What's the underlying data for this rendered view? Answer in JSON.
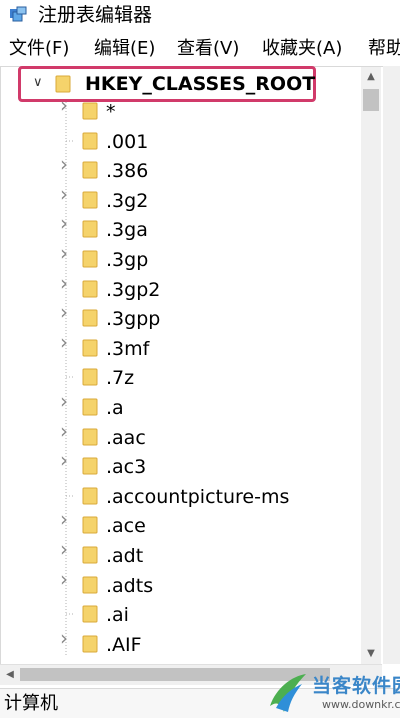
{
  "window": {
    "title": "注册表编辑器"
  },
  "menu": [
    "文件(F)",
    "编辑(E)",
    "查看(V)",
    "收藏夹(A)",
    "帮助(H)"
  ],
  "tree": {
    "root_label": "HKEY_CLASSES_ROOT",
    "items": [
      {
        "label": "*",
        "expandable": true
      },
      {
        "label": ".001",
        "expandable": false
      },
      {
        "label": ".386",
        "expandable": true
      },
      {
        "label": ".3g2",
        "expandable": true
      },
      {
        "label": ".3ga",
        "expandable": true
      },
      {
        "label": ".3gp",
        "expandable": true
      },
      {
        "label": ".3gp2",
        "expandable": true
      },
      {
        "label": ".3gpp",
        "expandable": true
      },
      {
        "label": ".3mf",
        "expandable": true
      },
      {
        "label": ".7z",
        "expandable": false
      },
      {
        "label": ".a",
        "expandable": true
      },
      {
        "label": ".aac",
        "expandable": true
      },
      {
        "label": ".ac3",
        "expandable": true
      },
      {
        "label": ".accountpicture-ms",
        "expandable": false
      },
      {
        "label": ".ace",
        "expandable": true
      },
      {
        "label": ".adt",
        "expandable": true
      },
      {
        "label": ".adts",
        "expandable": true
      },
      {
        "label": ".ai",
        "expandable": false
      },
      {
        "label": ".AIF",
        "expandable": true
      }
    ]
  },
  "status": {
    "path": "计算机"
  },
  "watermark": {
    "name": "当客软件园",
    "url": "www.downkr.com"
  },
  "colors": {
    "highlight_border": "#d13a6a",
    "folder": "#f5d36b",
    "folder_outline": "#d9a93a",
    "watermark_blue": "#3a86c8"
  }
}
